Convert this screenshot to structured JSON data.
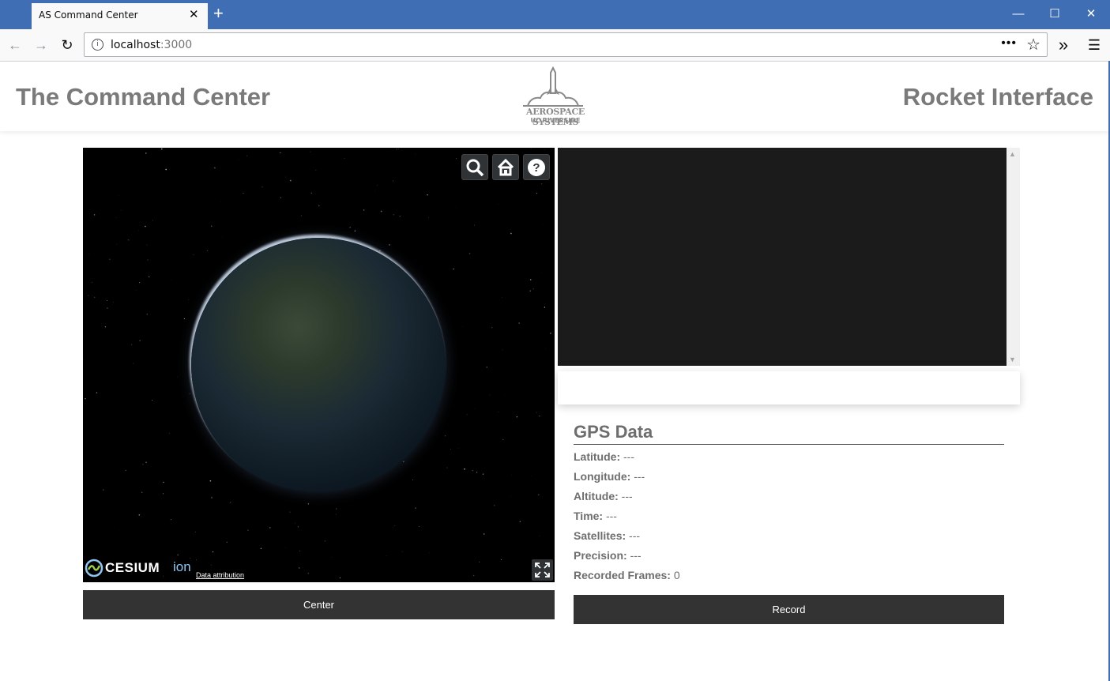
{
  "browser": {
    "tab_title": "AS Command Center",
    "url_host": "localhost",
    "url_port": ":3000",
    "close_glyph": "✕",
    "newtab_glyph": "+",
    "minimize_glyph": "—",
    "maximize_glyph": "☐",
    "winclose_glyph": "✕",
    "back_glyph": "←",
    "forward_glyph": "→",
    "reload_glyph": "↻",
    "info_glyph": "i",
    "more_glyph": "•••",
    "star_glyph": "☆",
    "overflow_glyph": "»",
    "menu_glyph": "☰"
  },
  "header": {
    "left_title": "The Command Center",
    "right_title": "Rocket Interface",
    "logo_line1": "AEROSPACE SYSTEMS",
    "logo_line2": "UC RIVERSIDE"
  },
  "viewer": {
    "cesium_word": "CESIUM",
    "cesium_ion": "ion",
    "attribution": "Data attribution",
    "center_button": "Center"
  },
  "gps": {
    "title": "GPS Data",
    "rows": [
      {
        "label": "Latitude:",
        "value": "---"
      },
      {
        "label": "Longitude:",
        "value": "---"
      },
      {
        "label": "Altitude:",
        "value": "---"
      },
      {
        "label": "Time:",
        "value": "---"
      },
      {
        "label": "Satellites:",
        "value": "---"
      },
      {
        "label": "Precision:",
        "value": "---"
      },
      {
        "label": "Recorded Frames:",
        "value": "0"
      }
    ],
    "record_button": "Record"
  },
  "colors": {
    "titlebar": "#3f6eb5",
    "button_bg": "#333333",
    "header_text": "#7a7a7a"
  }
}
